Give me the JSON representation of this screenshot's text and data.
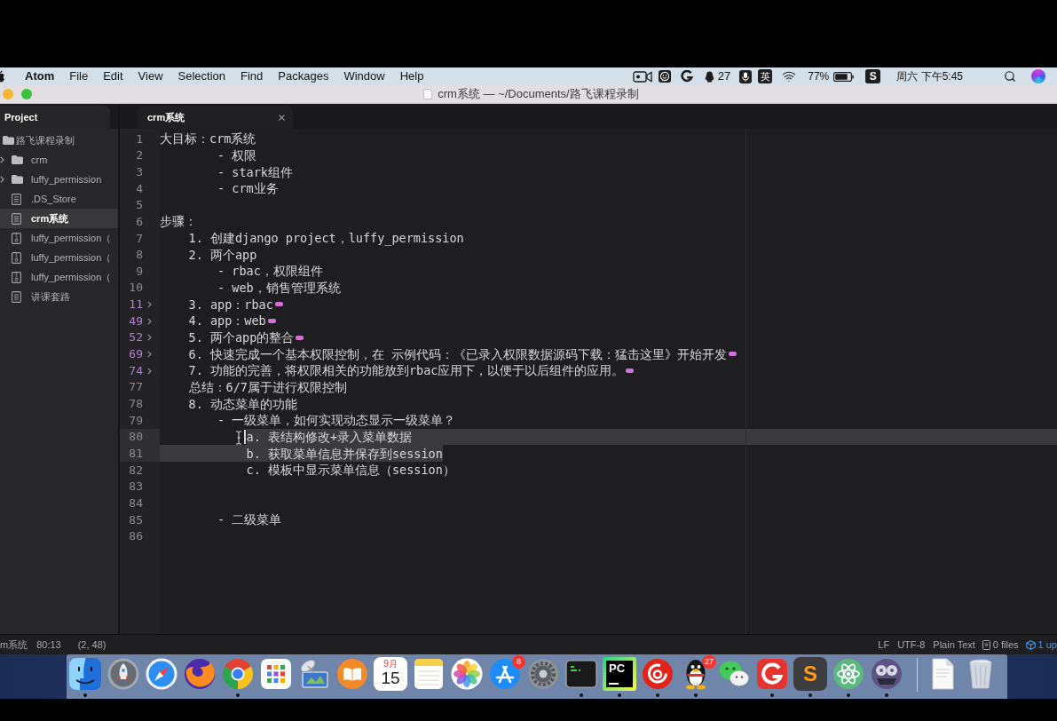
{
  "menu_bar": {
    "app_name": "Atom",
    "menus": [
      "File",
      "Edit",
      "View",
      "Selection",
      "Find",
      "Packages",
      "Window",
      "Help"
    ],
    "extras": [
      {
        "kind": "camera"
      },
      {
        "kind": "face"
      },
      {
        "kind": "g_logo"
      },
      {
        "kind": "qq",
        "label": "27"
      },
      {
        "kind": "mic"
      },
      {
        "kind": "input_source",
        "label": "英"
      },
      {
        "kind": "wifi"
      },
      {
        "kind": "battery",
        "label": "77%"
      },
      {
        "kind": "logo_s",
        "label": "S"
      },
      {
        "kind": "clock",
        "label": "周六 下午5:45"
      },
      {
        "kind": "search"
      },
      {
        "kind": "siri"
      }
    ]
  },
  "title_bar": {
    "title": "crm系统 — ~/Documents/路飞课程录制"
  },
  "tab_bar": {
    "panel_tab": "Project",
    "editor_tabs": [
      {
        "label": "crm系统",
        "selected": true
      }
    ]
  },
  "project_tree": [
    {
      "label": "路飞课程录制",
      "kind": "folder",
      "selected": false,
      "children": [
        {
          "label": "crm",
          "kind": "folder",
          "expanded": false,
          "selected": false
        },
        {
          "label": "luffy_permission",
          "kind": "folder",
          "expanded": false,
          "selected": false
        },
        {
          "label": ".DS_Store",
          "kind": "file",
          "selected": false
        },
        {
          "label": "crm系统",
          "kind": "file",
          "selected": true
        },
        {
          "label": "luffy_permission（",
          "kind": "archive",
          "selected": false
        },
        {
          "label": "luffy_permission（",
          "kind": "archive",
          "selected": false
        },
        {
          "label": "luffy_permission（",
          "kind": "archive",
          "selected": false
        },
        {
          "label": "讲课套路",
          "kind": "file",
          "selected": false
        }
      ]
    }
  ],
  "editor": {
    "lines": [
      {
        "number": "1",
        "text": "大目标：crm系统",
        "folded": false,
        "cursor": false,
        "selected": false
      },
      {
        "number": "2",
        "text": "        - 权限",
        "folded": false,
        "cursor": false,
        "selected": false
      },
      {
        "number": "3",
        "text": "        - stark组件",
        "folded": false,
        "cursor": false,
        "selected": false
      },
      {
        "number": "4",
        "text": "        - crm业务",
        "folded": false,
        "cursor": false,
        "selected": false
      },
      {
        "number": "5",
        "folded": false,
        "cursor": false,
        "selected": false
      },
      {
        "number": "6",
        "text": "步骤：",
        "folded": false,
        "cursor": false,
        "selected": false
      },
      {
        "number": "7",
        "text": "    1. 创建django project，luffy_permission",
        "folded": false,
        "cursor": false,
        "selected": false
      },
      {
        "number": "8",
        "text": "    2. 两个app",
        "folded": false,
        "cursor": false,
        "selected": false
      },
      {
        "number": "9",
        "text": "        - rbac，权限组件",
        "folded": false,
        "cursor": false,
        "selected": false
      },
      {
        "number": "10",
        "text": "        - web，销售管理系统",
        "folded": false,
        "cursor": false,
        "selected": false
      },
      {
        "number": "11",
        "text": "    3. app：rbac",
        "folded": true,
        "cursor": false,
        "selected": false
      },
      {
        "number": "49",
        "text": "    4. app：web",
        "folded": true,
        "cursor": false,
        "selected": false
      },
      {
        "number": "52",
        "text": "    5. 两个app的整合",
        "folded": true,
        "cursor": false,
        "selected": false
      },
      {
        "number": "69",
        "text": "    6. 快速完成一个基本权限控制，在 示例代码：《已录入权限数据源码下载：猛击这里》开始开发",
        "folded": true,
        "cursor": false,
        "selected": false
      },
      {
        "number": "74",
        "text": "    7. 功能的完善，将权限相关的功能放到rbac应用下，以便于以后组件的应用。",
        "folded": true,
        "cursor": false,
        "selected": false
      },
      {
        "number": "77",
        "text": "    总结：6/7属于进行权限控制",
        "folded": false,
        "cursor": false,
        "selected": false
      },
      {
        "number": "78",
        "text": "    8. 动态菜单的功能",
        "folded": false,
        "cursor": false,
        "selected": false
      },
      {
        "number": "79",
        "text": "        - 一级菜单，如何实现动态显示一级菜单？",
        "folded": false,
        "cursor": false,
        "selected": false
      },
      {
        "number": "80",
        "text": "            a. 表结构修改+录入菜单数据",
        "folded": false,
        "cursor": true,
        "selected": true,
        "selection_after_indent": true,
        "selection_extends": true
      },
      {
        "number": "81",
        "text": "            b. 获取菜单信息并保存到session",
        "folded": false,
        "cursor": false,
        "selected": true,
        "selection_after_indent": false,
        "selection_extends": false
      },
      {
        "number": "82",
        "text": "            c. 模板中显示菜单信息（session）",
        "folded": false,
        "cursor": false,
        "selected": false
      },
      {
        "number": "83",
        "folded": false,
        "cursor": false,
        "selected": false
      },
      {
        "number": "84",
        "folded": false,
        "cursor": false,
        "selected": false
      },
      {
        "number": "85",
        "text": "        - 二级菜单",
        "folded": false,
        "cursor": false,
        "selected": false
      },
      {
        "number": "86",
        "folded": false,
        "cursor": false,
        "selected": false
      }
    ]
  },
  "status_bar": {
    "file_name": "m系统",
    "cursor_position": "80:13",
    "selection_count": "(2, 48)",
    "line_ending": "LF",
    "encoding": "UTF-8",
    "grammar": "Plain Text",
    "git_status": "0 files",
    "updates": "1 up"
  },
  "dock": {
    "apps": [
      {
        "kind": "finder",
        "running": true
      },
      {
        "kind": "launchpad",
        "running": false
      },
      {
        "kind": "safari",
        "running": false
      },
      {
        "kind": "firefox",
        "running": false
      },
      {
        "kind": "chrome",
        "running": true
      },
      {
        "kind": "grid",
        "running": false
      },
      {
        "kind": "network",
        "running": false
      },
      {
        "kind": "books",
        "running": false
      },
      {
        "kind": "calendar",
        "month": "9月",
        "day": "15",
        "running": false
      },
      {
        "kind": "notes",
        "running": false
      },
      {
        "kind": "photos",
        "running": false
      },
      {
        "kind": "appstore",
        "badge": "8",
        "running": false
      },
      {
        "kind": "settings",
        "running": false
      },
      {
        "kind": "terminal",
        "running": true
      },
      {
        "kind": "pycharm",
        "label": "PC",
        "running": true
      },
      {
        "kind": "netease",
        "running": true
      },
      {
        "kind": "qq",
        "badge": "27",
        "running": true
      },
      {
        "kind": "wechat",
        "running": false
      },
      {
        "kind": "g_app",
        "running": true
      },
      {
        "kind": "sublime",
        "label": "S",
        "running": true
      },
      {
        "kind": "atom",
        "running": true
      },
      {
        "kind": "video",
        "running": true
      }
    ],
    "others": [
      {
        "kind": "document"
      },
      {
        "kind": "trash"
      }
    ]
  }
}
